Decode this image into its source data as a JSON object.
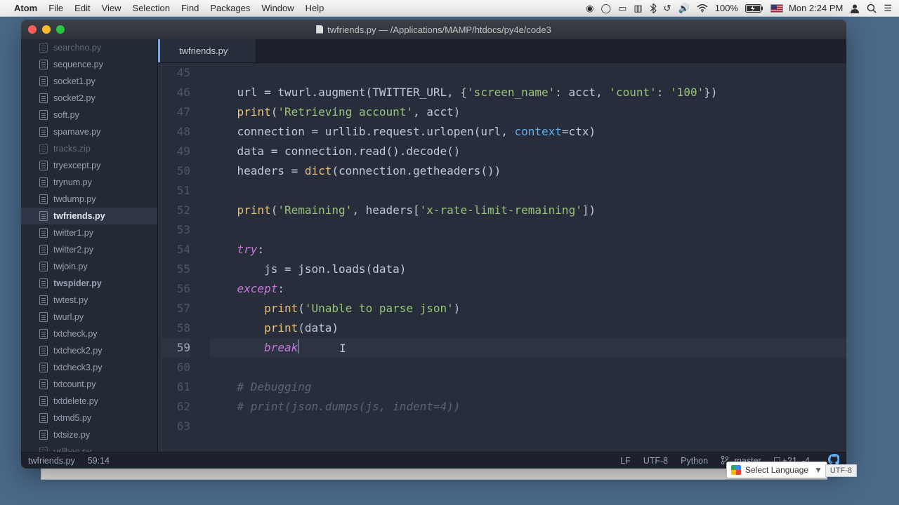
{
  "menubar": {
    "app": "Atom",
    "items": [
      "File",
      "Edit",
      "View",
      "Selection",
      "Find",
      "Packages",
      "Window",
      "Help"
    ],
    "battery": "100%",
    "clock": "Mon 2:24 PM"
  },
  "window": {
    "title": "twfriends.py — /Applications/MAMP/htdocs/py4e/code3"
  },
  "tree": {
    "files": [
      {
        "name": "searchno.py",
        "dim": true
      },
      {
        "name": "sequence.py"
      },
      {
        "name": "socket1.py"
      },
      {
        "name": "socket2.py"
      },
      {
        "name": "soft.py"
      },
      {
        "name": "spamave.py"
      },
      {
        "name": "tracks.zip",
        "dim": true
      },
      {
        "name": "tryexcept.py"
      },
      {
        "name": "trynum.py"
      },
      {
        "name": "twdump.py"
      },
      {
        "name": "twfriends.py",
        "selected": true,
        "bold": true
      },
      {
        "name": "twitter1.py"
      },
      {
        "name": "twitter2.py"
      },
      {
        "name": "twjoin.py"
      },
      {
        "name": "twspider.py",
        "bold": true
      },
      {
        "name": "twtest.py"
      },
      {
        "name": "twurl.py"
      },
      {
        "name": "txtcheck.py"
      },
      {
        "name": "txtcheck2.py"
      },
      {
        "name": "txtcheck3.py"
      },
      {
        "name": "txtcount.py"
      },
      {
        "name": "txtdelete.py"
      },
      {
        "name": "txtmd5.py"
      },
      {
        "name": "txtsize.py"
      },
      {
        "name": "urlibeo.pv",
        "dim": true
      }
    ]
  },
  "tab": {
    "label": "twfriends.py"
  },
  "gutter_start": 45,
  "code_lines": [
    {
      "n": 45,
      "seg": [
        {
          "c": "pl",
          "t": "    "
        }
      ]
    },
    {
      "n": 46,
      "seg": [
        {
          "c": "pl",
          "t": "    url = twurl.augment(TWITTER_URL, {"
        },
        {
          "c": "str",
          "t": "'screen_name'"
        },
        {
          "c": "pl",
          "t": ": acct, "
        },
        {
          "c": "str",
          "t": "'count'"
        },
        {
          "c": "pl",
          "t": ": "
        },
        {
          "c": "str",
          "t": "'100'"
        },
        {
          "c": "pl",
          "t": "})"
        }
      ]
    },
    {
      "n": 47,
      "seg": [
        {
          "c": "pl",
          "t": "    "
        },
        {
          "c": "builtin",
          "t": "print"
        },
        {
          "c": "pl",
          "t": "("
        },
        {
          "c": "str",
          "t": "'Retrieving account'"
        },
        {
          "c": "pl",
          "t": ", acct)"
        }
      ]
    },
    {
      "n": 48,
      "seg": [
        {
          "c": "pl",
          "t": "    connection = urllib.request.urlopen(url, "
        },
        {
          "c": "fn",
          "t": "context"
        },
        {
          "c": "pl",
          "t": "=ctx)"
        }
      ]
    },
    {
      "n": 49,
      "seg": [
        {
          "c": "pl",
          "t": "    data = connection.read().decode()"
        }
      ]
    },
    {
      "n": 50,
      "seg": [
        {
          "c": "pl",
          "t": "    headers = "
        },
        {
          "c": "builtin",
          "t": "dict"
        },
        {
          "c": "pl",
          "t": "(connection.getheaders())"
        }
      ]
    },
    {
      "n": 51,
      "seg": [
        {
          "c": "pl",
          "t": ""
        }
      ]
    },
    {
      "n": 52,
      "seg": [
        {
          "c": "pl",
          "t": "    "
        },
        {
          "c": "builtin",
          "t": "print"
        },
        {
          "c": "pl",
          "t": "("
        },
        {
          "c": "str",
          "t": "'Remaining'"
        },
        {
          "c": "pl",
          "t": ", headers["
        },
        {
          "c": "str",
          "t": "'x-rate-limit-remaining'"
        },
        {
          "c": "pl",
          "t": "])"
        }
      ]
    },
    {
      "n": 53,
      "seg": [
        {
          "c": "pl",
          "t": ""
        }
      ]
    },
    {
      "n": 54,
      "seg": [
        {
          "c": "pl",
          "t": "    "
        },
        {
          "c": "kw",
          "t": "try"
        },
        {
          "c": "pl",
          "t": ":"
        }
      ]
    },
    {
      "n": 55,
      "seg": [
        {
          "c": "pl",
          "t": "        js = json.loads(data)"
        }
      ]
    },
    {
      "n": 56,
      "seg": [
        {
          "c": "pl",
          "t": "    "
        },
        {
          "c": "kw",
          "t": "except"
        },
        {
          "c": "pl",
          "t": ":"
        }
      ]
    },
    {
      "n": 57,
      "seg": [
        {
          "c": "pl",
          "t": "        "
        },
        {
          "c": "builtin",
          "t": "print"
        },
        {
          "c": "pl",
          "t": "("
        },
        {
          "c": "str",
          "t": "'Unable to parse json'"
        },
        {
          "c": "pl",
          "t": ")"
        }
      ]
    },
    {
      "n": 58,
      "seg": [
        {
          "c": "pl",
          "t": "        "
        },
        {
          "c": "builtin",
          "t": "print"
        },
        {
          "c": "pl",
          "t": "(data)"
        }
      ]
    },
    {
      "n": 59,
      "cursor": true,
      "seg": [
        {
          "c": "pl",
          "t": "        "
        },
        {
          "c": "kw",
          "t": "break"
        }
      ],
      "caret_after": true,
      "extra_caret_offset": "      "
    },
    {
      "n": 60,
      "seg": [
        {
          "c": "pl",
          "t": ""
        }
      ]
    },
    {
      "n": 61,
      "seg": [
        {
          "c": "pl",
          "t": "    "
        },
        {
          "c": "cm",
          "t": "# Debugging"
        }
      ]
    },
    {
      "n": 62,
      "seg": [
        {
          "c": "pl",
          "t": "    "
        },
        {
          "c": "cm",
          "t": "# print(json.dumps(js, indent=4))"
        }
      ]
    },
    {
      "n": 63,
      "seg": [
        {
          "c": "pl",
          "t": ""
        }
      ]
    }
  ],
  "statusbar": {
    "file": "twfriends.py",
    "pos": "59:14",
    "eol": "LF",
    "enc": "UTF-8",
    "lang": "Python",
    "branch": "master",
    "diff": "+21, -4"
  },
  "lang_widget": {
    "label": "Select Language"
  },
  "utf_badge": "UTF-8"
}
